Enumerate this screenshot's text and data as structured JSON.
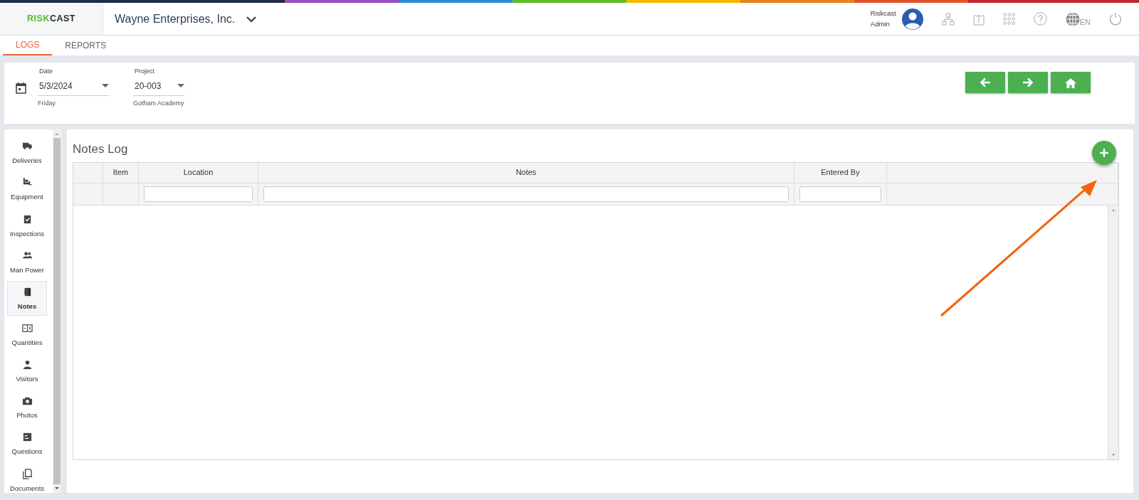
{
  "header": {
    "logo": [
      "RISK",
      "CAST"
    ],
    "company": "Wayne Enterprises, Inc.",
    "user": [
      "Riskcast",
      "Admin"
    ],
    "language": "EN"
  },
  "tabs": [
    {
      "label": "LOGS",
      "selected": true
    },
    {
      "label": "REPORTS",
      "selected": false
    }
  ],
  "filters": [
    {
      "label": "Date",
      "value": "5/3/2024",
      "note": "Friday"
    },
    {
      "label": "Project",
      "value": "20-003",
      "note": "Gotham Academy"
    }
  ],
  "sidebar": {
    "items": [
      {
        "label": "Deliveries",
        "selected": false
      },
      {
        "label": "Equipment",
        "selected": false
      },
      {
        "label": "Inspections",
        "selected": false
      },
      {
        "label": "Man Power",
        "selected": false
      },
      {
        "label": "Notes",
        "selected": true
      },
      {
        "label": "Quantities",
        "selected": false
      },
      {
        "label": "Visitors",
        "selected": false
      },
      {
        "label": "Photos",
        "selected": false
      },
      {
        "label": "Questions",
        "selected": false
      },
      {
        "label": "Documents",
        "selected": false
      }
    ]
  },
  "notes_log": {
    "title": "Notes Log",
    "columns": [
      {
        "kind": "blank"
      },
      {
        "kind": "heading",
        "label": "Item",
        "filter": false
      },
      {
        "kind": "heading",
        "label": "Location",
        "filter": true
      },
      {
        "kind": "heading",
        "label": "Notes",
        "filter": true
      },
      {
        "kind": "heading",
        "label": "Entered By",
        "filter": true
      },
      {
        "kind": "blank"
      }
    ]
  }
}
